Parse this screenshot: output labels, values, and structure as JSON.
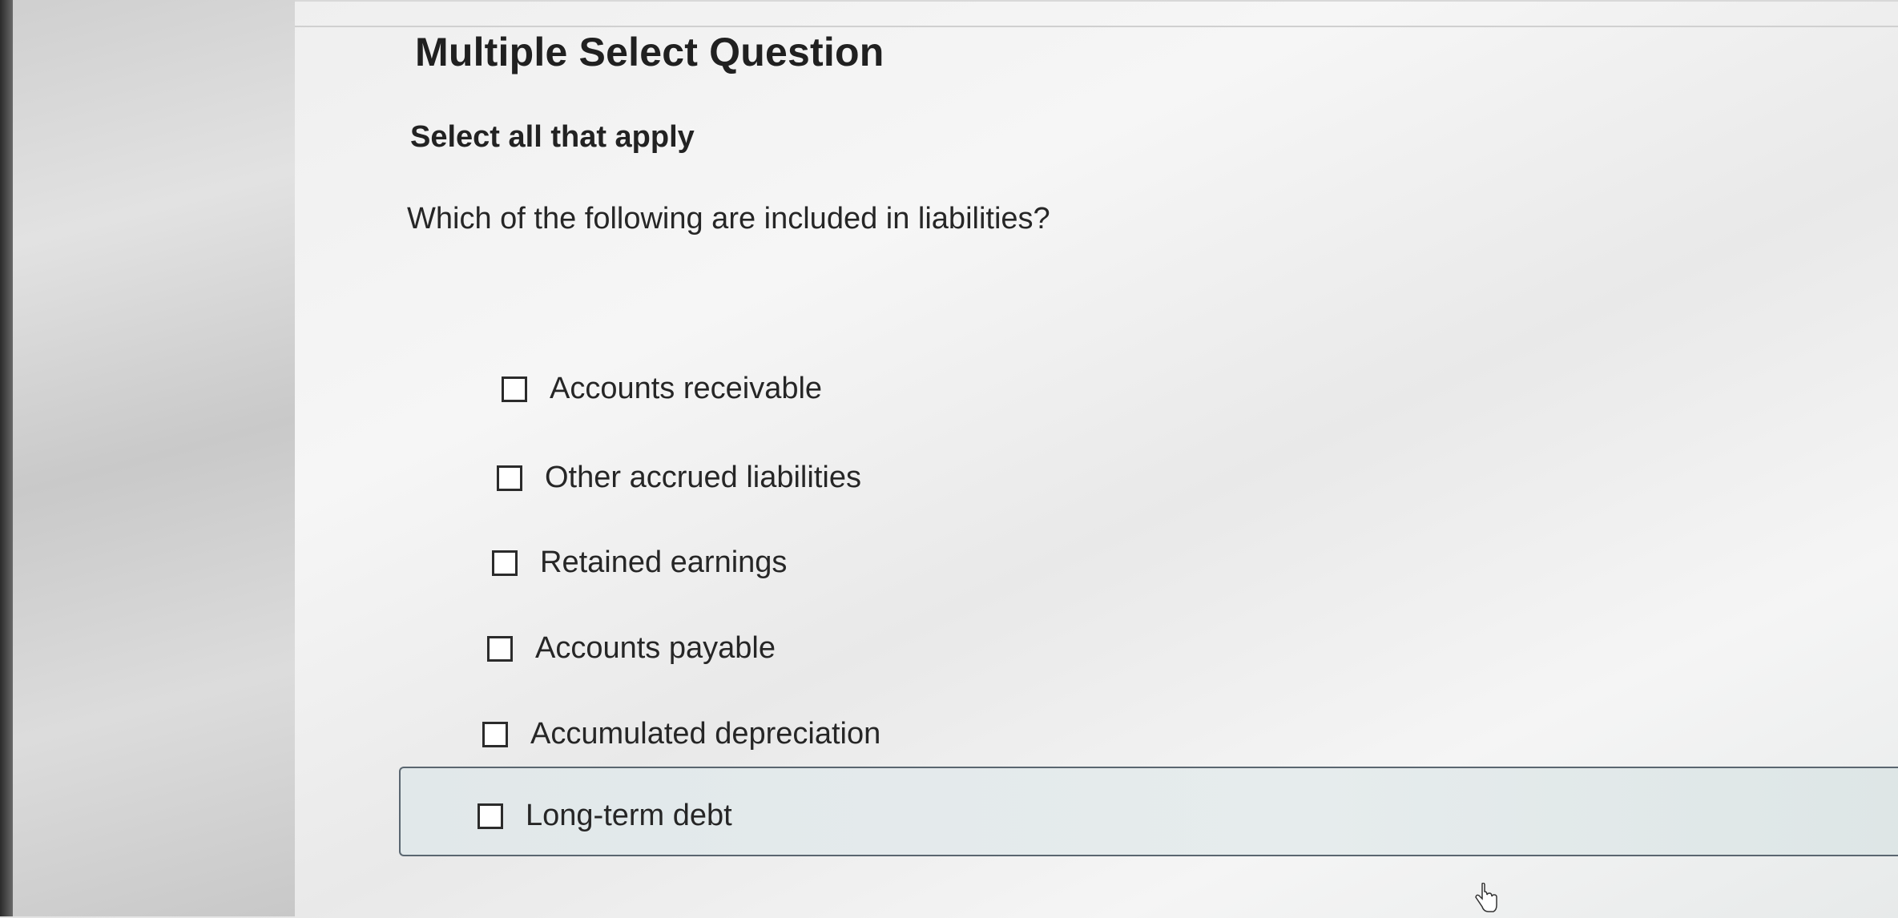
{
  "header": {
    "question_type": "Multiple Select Question"
  },
  "question": {
    "instruction": "Select all that apply",
    "prompt": "Which of the following are included in liabilities?"
  },
  "options": [
    {
      "label": "Accounts receivable",
      "checked": false
    },
    {
      "label": "Other accrued liabilities",
      "checked": false
    },
    {
      "label": "Retained earnings",
      "checked": false
    },
    {
      "label": "Accounts payable",
      "checked": false
    },
    {
      "label": "Accumulated depreciation",
      "checked": false
    },
    {
      "label": "Long-term debt",
      "checked": false,
      "highlighted": true
    }
  ],
  "icons": {
    "checkbox": "checkbox-unchecked-icon",
    "cursor": "hand-pointer-icon"
  },
  "colors": {
    "highlight_bg": "#e3eaeb",
    "highlight_border": "#5a6670",
    "text": "#262626"
  }
}
